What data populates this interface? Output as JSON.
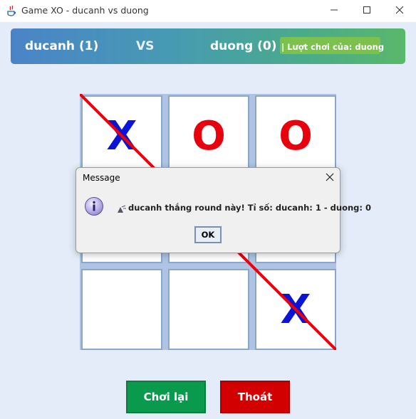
{
  "window": {
    "title": "Game XO - ducanh vs duong",
    "minimize_icon": "minimize-icon",
    "maximize_icon": "maximize-icon",
    "close_icon": "close-icon"
  },
  "header": {
    "player1": "ducanh (1)",
    "vs": "VS",
    "player2": "duong (0)",
    "turn_label": "| Lượt chơi của: duong"
  },
  "board": {
    "cells": [
      "X",
      "O",
      "O",
      "",
      "",
      "",
      "",
      "",
      "X"
    ],
    "winning_line": "diagonal-top-left-to-bottom-right",
    "colors": {
      "x": "#0a14d8",
      "o": "#e8000c",
      "line": "#e8000c"
    }
  },
  "buttons": {
    "replay": "Chơi lại",
    "exit": "Thoát"
  },
  "dialog": {
    "title": "Message",
    "message": "ducanh thắng round này! Tỉ số: ducanh: 1 - duong: 0",
    "ok": "OK",
    "icon": "info-icon"
  }
}
